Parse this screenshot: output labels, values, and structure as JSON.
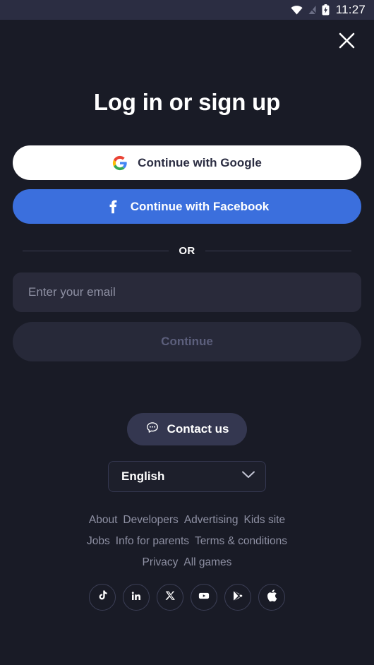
{
  "statusbar": {
    "time": "11:27",
    "icons": [
      "wifi-icon",
      "signal-off-icon",
      "battery-charging-icon"
    ]
  },
  "dialog": {
    "close_icon": "close-icon",
    "title": "Log in or sign up"
  },
  "auth": {
    "google": {
      "label": "Continue with Google",
      "icon": "google-icon",
      "bg": "#ffffff",
      "fg": "#2b2d42"
    },
    "facebook": {
      "label": "Continue with Facebook",
      "icon": "facebook-icon",
      "bg": "#3b6fdd",
      "fg": "#ffffff"
    },
    "divider_label": "OR"
  },
  "email": {
    "placeholder": "Enter your email",
    "value": ""
  },
  "continue": {
    "label": "Continue",
    "disabled": true
  },
  "contact": {
    "label": "Contact us",
    "icon": "chat-bubble-icon"
  },
  "language": {
    "selected": "English",
    "chevron_icon": "chevron-down-icon"
  },
  "footer": {
    "links": [
      "About",
      "Developers",
      "Advertising",
      "Kids site",
      "Jobs",
      "Info for parents",
      "Terms & conditions",
      "Privacy",
      "All games"
    ],
    "socials": [
      "tiktok-icon",
      "linkedin-icon",
      "x-icon",
      "youtube-icon",
      "google-play-icon",
      "apple-icon"
    ]
  },
  "colors": {
    "page_bg": "#191b26",
    "statusbar_bg": "#2b2d42",
    "field_bg": "#292a3a",
    "muted_text": "#8e90a3",
    "facebook_blue": "#3b6fdd"
  }
}
